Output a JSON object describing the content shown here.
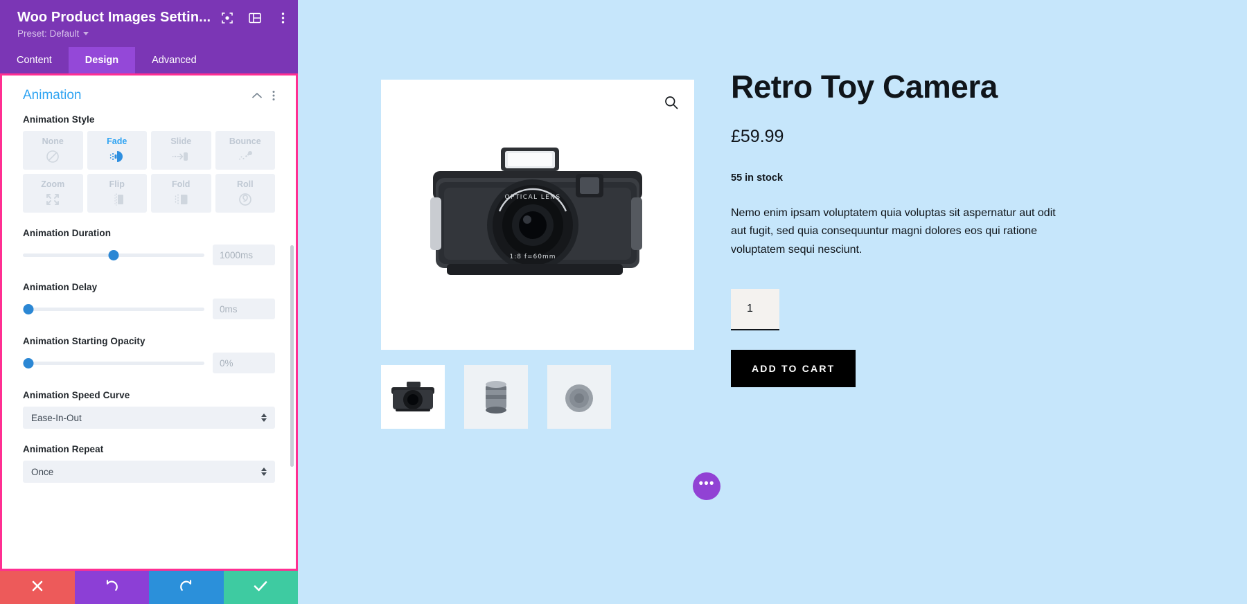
{
  "panel": {
    "title": "Woo Product Images Settin...",
    "preset_label": "Preset: Default",
    "header_icons": [
      "target-icon",
      "layout-icon",
      "more-vertical-icon"
    ],
    "tabs": [
      {
        "label": "Content",
        "active": false
      },
      {
        "label": "Design",
        "active": true
      },
      {
        "label": "Advanced",
        "active": false
      }
    ],
    "section": {
      "title": "Animation",
      "collapse_icon": "chevron-up-icon",
      "more_icon": "more-vertical-icon"
    },
    "fields": {
      "animation_style_label": "Animation Style",
      "animation_styles": [
        {
          "label": "None",
          "icon": "no-entry-icon",
          "selected": false
        },
        {
          "label": "Fade",
          "icon": "fade-icon",
          "selected": true
        },
        {
          "label": "Slide",
          "icon": "slide-icon",
          "selected": false
        },
        {
          "label": "Bounce",
          "icon": "bounce-icon",
          "selected": false
        },
        {
          "label": "Zoom",
          "icon": "zoom-arrows-icon",
          "selected": false
        },
        {
          "label": "Flip",
          "icon": "flip-icon",
          "selected": false
        },
        {
          "label": "Fold",
          "icon": "fold-icon",
          "selected": false
        },
        {
          "label": "Roll",
          "icon": "roll-spiral-icon",
          "selected": false
        }
      ],
      "duration_label": "Animation Duration",
      "duration_value": "1000ms",
      "duration_percent": 50,
      "delay_label": "Animation Delay",
      "delay_value": "0ms",
      "delay_percent": 3,
      "opacity_label": "Animation Starting Opacity",
      "opacity_value": "0%",
      "opacity_percent": 3,
      "speed_curve_label": "Animation Speed Curve",
      "speed_curve_value": "Ease-In-Out",
      "repeat_label": "Animation Repeat",
      "repeat_value": "Once"
    },
    "footer": [
      {
        "name": "cancel-button",
        "icon": "close-icon"
      },
      {
        "name": "undo-button",
        "icon": "undo-icon"
      },
      {
        "name": "redo-button",
        "icon": "redo-icon"
      },
      {
        "name": "save-button",
        "icon": "check-icon"
      }
    ]
  },
  "preview": {
    "zoom_icon": "magnifier-icon",
    "product": {
      "title": "Retro Toy Camera",
      "price": "£59.99",
      "stock": "55 in stock",
      "description": "Nemo enim ipsam voluptatem quia voluptas sit aspernatur aut odit aut fugit, sed quia consequuntur magni dolores eos qui ratione voluptatem sequi nesciunt.",
      "quantity": "1",
      "add_to_cart_label": "ADD TO CART"
    },
    "fab_icon": "ellipsis-icon",
    "colors": {
      "page_background": "#c6e6fb",
      "accent_pink": "#ff2f92",
      "panel_purple": "#7b36b5",
      "tab_active": "#9448d8",
      "link_blue": "#2ea3f2"
    }
  }
}
